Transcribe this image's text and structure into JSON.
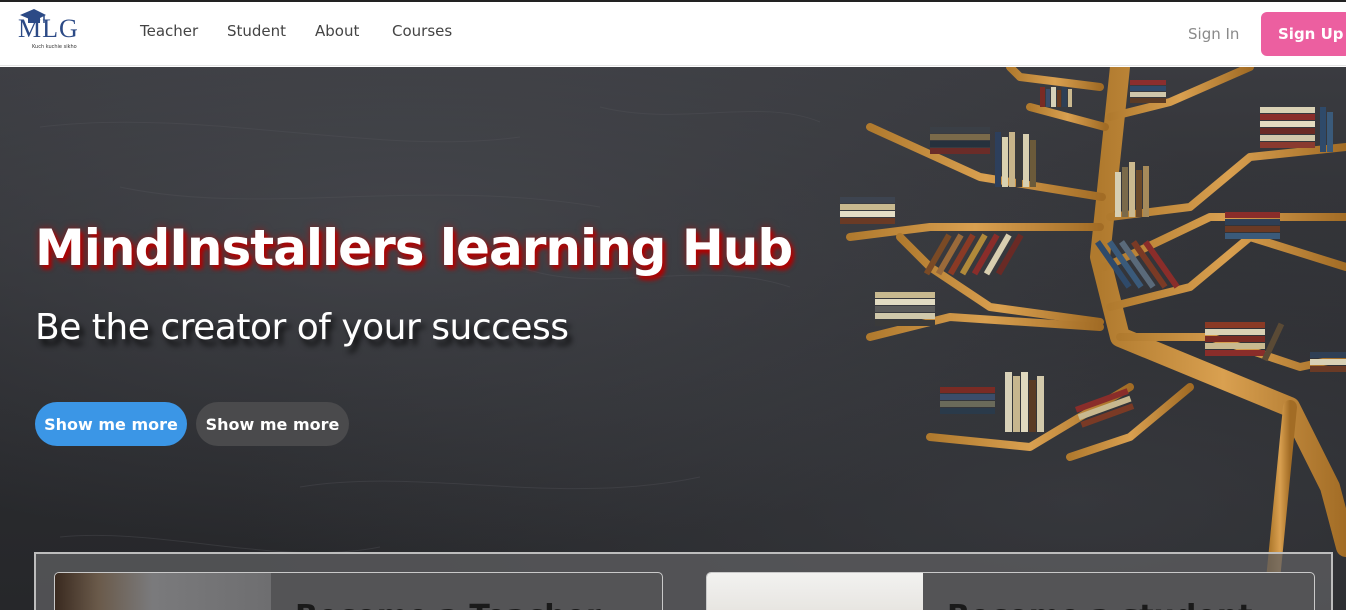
{
  "app": {
    "logo_text": "MLG",
    "logo_tagline": "Kuch kuchie sikho"
  },
  "nav": {
    "links": [
      {
        "label": "Teacher"
      },
      {
        "label": "Student"
      },
      {
        "label": "About"
      },
      {
        "label": "Courses"
      }
    ],
    "signin_label": "Sign In",
    "signup_label": "Sign Up"
  },
  "hero": {
    "title": "MindInstallers learning Hub",
    "subtitle": "Be the creator of your success",
    "primary_button": "Show me more",
    "secondary_button": "Show me more"
  },
  "cards": [
    {
      "title": "Become a Teacher"
    },
    {
      "title": "Become a student"
    }
  ],
  "colors": {
    "accent_blue": "#3b96e6",
    "signup_pink": "#ec5fa0",
    "title_glow": "#b10000"
  }
}
